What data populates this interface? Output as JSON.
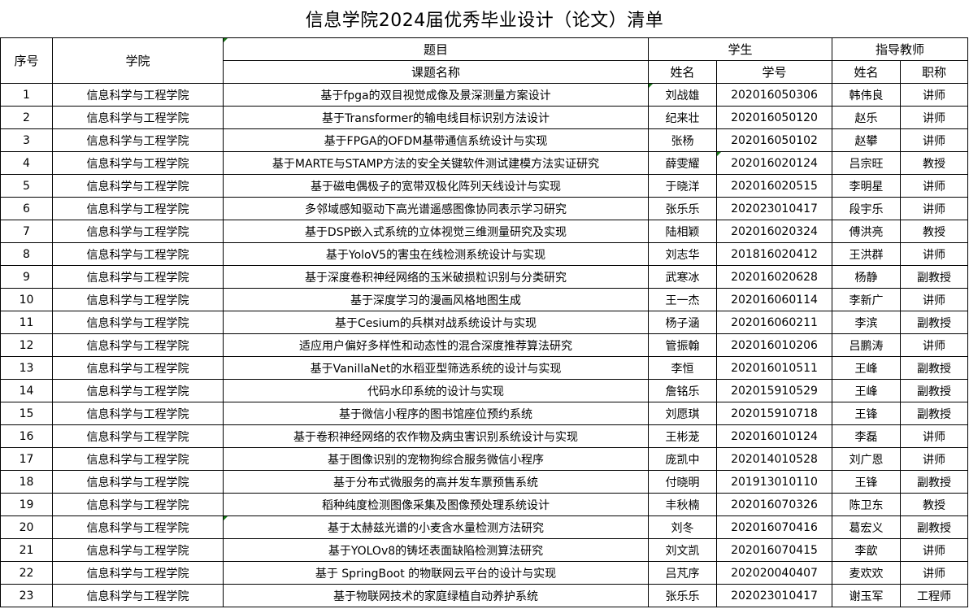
{
  "title": "信息学院2024届优秀毕业设计（论文）清单",
  "headers": {
    "seq": "序号",
    "college": "学院",
    "topic_group": "题目",
    "topic": "课题名称",
    "student_group": "学生",
    "student_name": "姓名",
    "student_id": "学号",
    "advisor_group": "指导教师",
    "advisor_name": "姓名",
    "advisor_title": "职称"
  },
  "rows": [
    {
      "seq": "1",
      "college": "信息科学与工程学院",
      "topic": "基于fpga的双目视觉成像及景深测量方案设计",
      "student": "刘战雄",
      "id": "202016050306",
      "advisor": "韩伟良",
      "rank": "讲师"
    },
    {
      "seq": "2",
      "college": "信息科学与工程学院",
      "topic": "基于Transformer的输电线目标识别方法设计",
      "student": "纪来壮",
      "id": "202016050120",
      "advisor": "赵乐",
      "rank": "讲师"
    },
    {
      "seq": "3",
      "college": "信息科学与工程学院",
      "topic": "基于FPGA的OFDM基带通信系统设计与实现",
      "student": "张杨",
      "id": "202016050102",
      "advisor": "赵攀",
      "rank": "讲师"
    },
    {
      "seq": "4",
      "college": "信息科学与工程学院",
      "topic": "基于MARTE与STAMP方法的安全关键软件测试建模方法实证研究",
      "student": "薛雯耀",
      "id": "202016020124",
      "advisor": "吕宗旺",
      "rank": "教授"
    },
    {
      "seq": "5",
      "college": "信息科学与工程学院",
      "topic": "基于磁电偶极子的宽带双极化阵列天线设计与实现",
      "student": "于晓洋",
      "id": "202016020515",
      "advisor": "李明星",
      "rank": "讲师"
    },
    {
      "seq": "6",
      "college": "信息科学与工程学院",
      "topic": "多邻域感知驱动下高光谱遥感图像协同表示学习研究",
      "student": "张乐乐",
      "id": "202023010417",
      "advisor": "段宇乐",
      "rank": "讲师"
    },
    {
      "seq": "7",
      "college": "信息科学与工程学院",
      "topic": "基于DSP嵌入式系统的立体视觉三维测量研究及实现",
      "student": "陆相颖",
      "id": "202016020324",
      "advisor": "傅洪亮",
      "rank": "教授"
    },
    {
      "seq": "8",
      "college": "信息科学与工程学院",
      "topic": "基于YoloV5的害虫在线检测系统设计与实现",
      "student": "刘志华",
      "id": "201816020412",
      "advisor": "王洪群",
      "rank": "讲师"
    },
    {
      "seq": "9",
      "college": "信息科学与工程学院",
      "topic": "基于深度卷积神经网络的玉米破损粒识别与分类研究",
      "student": "武寒冰",
      "id": "202016020628",
      "advisor": "杨静",
      "rank": "副教授"
    },
    {
      "seq": "10",
      "college": "信息科学与工程学院",
      "topic": "基于深度学习的漫画风格地图生成",
      "student": "王一杰",
      "id": "202016060114",
      "advisor": "李新广",
      "rank": "讲师"
    },
    {
      "seq": "11",
      "college": "信息科学与工程学院",
      "topic": "基于Cesium的兵棋对战系统设计与实现",
      "student": "杨子涵",
      "id": "202016060211",
      "advisor": "李滨",
      "rank": "副教授"
    },
    {
      "seq": "12",
      "college": "信息科学与工程学院",
      "topic": "适应用户偏好多样性和动态性的混合深度推荐算法研究",
      "student": "管振翰",
      "id": "202016010206",
      "advisor": "吕鹏涛",
      "rank": "讲师"
    },
    {
      "seq": "13",
      "college": "信息科学与工程学院",
      "topic": "基于VanillaNet的水稻亚型筛选系统的设计与实现",
      "student": "李恒",
      "id": "202016010511",
      "advisor": "王峰",
      "rank": "副教授"
    },
    {
      "seq": "14",
      "college": "信息科学与工程学院",
      "topic": "代码水印系统的设计与实现",
      "student": "詹铭乐",
      "id": "202015910529",
      "advisor": "王峰",
      "rank": "副教授"
    },
    {
      "seq": "15",
      "college": "信息科学与工程学院",
      "topic": "基于微信小程序的图书馆座位预约系统",
      "student": "刘愿琪",
      "id": "202015910718",
      "advisor": "王锋",
      "rank": "副教授"
    },
    {
      "seq": "16",
      "college": "信息科学与工程学院",
      "topic": "基于卷积神经网络的农作物及病虫害识别系统设计与实现",
      "student": "王彬茏",
      "id": "202016010124",
      "advisor": "李磊",
      "rank": "讲师"
    },
    {
      "seq": "17",
      "college": "信息科学与工程学院",
      "topic": "基于图像识别的宠物狗综合服务微信小程序",
      "student": "庞凯中",
      "id": "202014010528",
      "advisor": "刘广恩",
      "rank": "讲师"
    },
    {
      "seq": "18",
      "college": "信息科学与工程学院",
      "topic": "基于分布式微服务的高并发车票预售系统",
      "student": "付晓明",
      "id": "201913010110",
      "advisor": "王锋",
      "rank": "副教授"
    },
    {
      "seq": "19",
      "college": "信息科学与工程学院",
      "topic": "稻种纯度检测图像采集及图像预处理系统设计",
      "student": "丰秋楠",
      "id": "202016070326",
      "advisor": "陈卫东",
      "rank": "教授"
    },
    {
      "seq": "20",
      "college": "信息科学与工程学院",
      "topic": "基于太赫兹光谱的小麦含水量检测方法研究",
      "student": "刘冬",
      "id": "202016070416",
      "advisor": "葛宏义",
      "rank": "副教授"
    },
    {
      "seq": "21",
      "college": "信息科学与工程学院",
      "topic": "基于YOLOv8的铸坯表面缺陷检测算法研究",
      "student": "刘文凯",
      "id": "202016070415",
      "advisor": "李歆",
      "rank": "讲师"
    },
    {
      "seq": "22",
      "college": "信息科学与工程学院",
      "topic": "基于 SpringBoot 的物联网云平台的设计与实现",
      "student": "吕芃序",
      "id": "202020040407",
      "advisor": "麦欢欢",
      "rank": "讲师"
    },
    {
      "seq": "23",
      "college": "信息科学与工程学院",
      "topic": "基于物联网技术的家庭绿植自动养护系统",
      "student": "张乐乐",
      "id": "202023010417",
      "advisor": "谢玉军",
      "rank": "工程师"
    }
  ]
}
